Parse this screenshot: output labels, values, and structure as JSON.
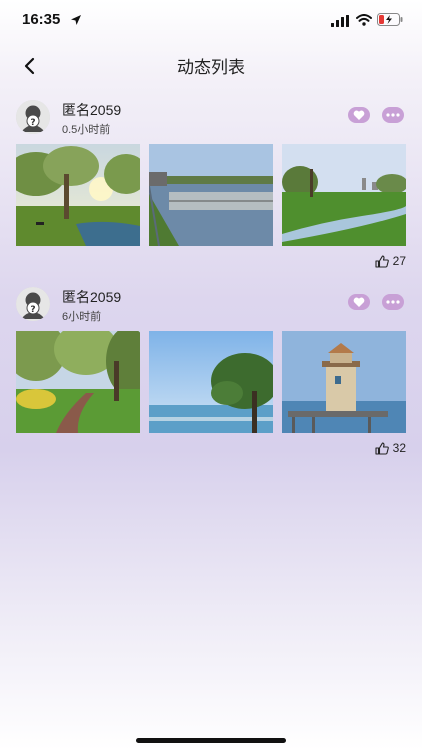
{
  "status_bar": {
    "time": "16:35"
  },
  "nav": {
    "title": "动态列表"
  },
  "posts": [
    {
      "username": "匿名2059",
      "time_ago": "0.5小时前",
      "likes": "27",
      "photos": [
        "park-willow-sunset",
        "wetland-pier-boardwalk",
        "park-lawn-stream"
      ]
    },
    {
      "username": "匿名2059",
      "time_ago": "6小时前",
      "likes": "32",
      "photos": [
        "park-path-willows",
        "lakeshore-tree",
        "lighthouse-pier"
      ]
    }
  ],
  "colors": {
    "accent": "#c8a0d6"
  }
}
